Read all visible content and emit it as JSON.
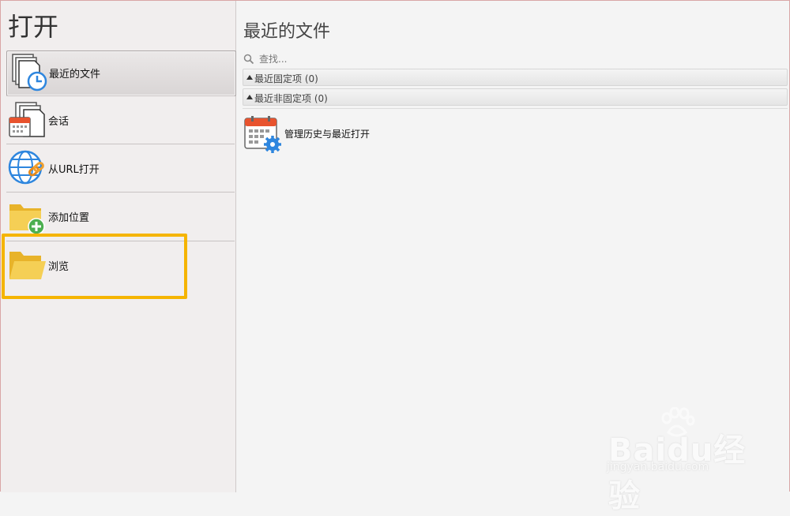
{
  "left_panel": {
    "title": "打开",
    "items": [
      {
        "label": "最近的文件",
        "icon": "recent-files-clock-icon",
        "selected": true
      },
      {
        "label": "会话",
        "icon": "session-calendar-icon",
        "selected": false
      },
      {
        "label": "从URL打开",
        "icon": "globe-link-icon",
        "selected": false
      },
      {
        "label": "添加位置",
        "icon": "folder-add-icon",
        "selected": false
      },
      {
        "label": "浏览",
        "icon": "folder-open-icon",
        "selected": false
      }
    ]
  },
  "main": {
    "title": "最近的文件",
    "search": {
      "placeholder": "查找...",
      "value": ""
    },
    "groups": [
      {
        "label": "最近固定项 (0)"
      },
      {
        "label": "最近非固定项 (0)"
      }
    ],
    "manage": {
      "label": "管理历史与最近打开",
      "icon": "calendar-gear-icon"
    }
  },
  "watermark": {
    "brand": "Baidu经验",
    "site": "jingyan.baidu.com"
  },
  "colors": {
    "highlight": "#f5b400",
    "folder": "#f2c53d",
    "accent_blue": "#2e86de",
    "calendar_red": "#e8532e"
  }
}
